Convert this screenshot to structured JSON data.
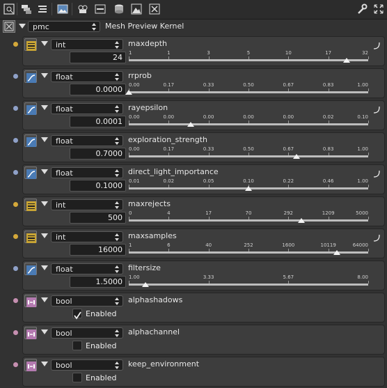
{
  "toolbar": {
    "icons": [
      "render-region-icon",
      "layers-icon",
      "list-icon",
      "picture-icon",
      "camera-icon",
      "film-settings-icon",
      "cylinder-icon",
      "image-icon",
      "fit-icon",
      "wrench-icon",
      "expand-icon"
    ]
  },
  "kernel": {
    "name": "pmc",
    "label": "Mesh Preview Kernel"
  },
  "colors": {
    "pin_int": "#d4a83a",
    "pin_float": "#8fa1c8",
    "pin_bool": "#c58fb0",
    "icon_int": "#c9a534",
    "icon_float": "#4a7bb5",
    "icon_bool": "#b47ab0"
  },
  "params": [
    {
      "type": "int",
      "name": "maxdepth",
      "value": "24",
      "ticks": [
        "1",
        "1",
        "3",
        "5",
        "10",
        "17",
        "32"
      ],
      "slider_fraction": 0.91,
      "has_curve": true
    },
    {
      "type": "float",
      "name": "rrprob",
      "value": "0.0000",
      "ticks": [
        "0.00",
        "0.17",
        "0.33",
        "0.50",
        "0.67",
        "0.83",
        "1.00"
      ],
      "slider_fraction": 0.0,
      "has_curve": false
    },
    {
      "type": "float",
      "name": "rayepsilon",
      "value": "0.0001",
      "ticks": [
        "0.00",
        "0.00",
        "0.00",
        "0.00",
        "0.00",
        "0.02",
        "0.10"
      ],
      "slider_fraction": 0.26,
      "has_curve": true
    },
    {
      "type": "float",
      "name": "exploration_strength",
      "value": "0.7000",
      "ticks": [
        "0.00",
        "0.17",
        "0.33",
        "0.50",
        "0.67",
        "0.83",
        "1.00"
      ],
      "slider_fraction": 0.7,
      "has_curve": false
    },
    {
      "type": "float",
      "name": "direct_light_importance",
      "value": "0.1000",
      "ticks": [
        "0.01",
        "0.02",
        "0.05",
        "0.10",
        "0.22",
        "0.46",
        "1.00"
      ],
      "slider_fraction": 0.5,
      "has_curve": true
    },
    {
      "type": "int",
      "name": "maxrejects",
      "value": "500",
      "ticks": [
        "0",
        "4",
        "17",
        "70",
        "292",
        "1209",
        "5000"
      ],
      "slider_fraction": 0.72,
      "has_curve": false
    },
    {
      "type": "int",
      "name": "maxsamples",
      "value": "16000",
      "ticks": [
        "1",
        "6",
        "40",
        "252",
        "1600",
        "10119",
        "64000"
      ],
      "slider_fraction": 0.87,
      "has_curve": true
    },
    {
      "type": "float",
      "name": "filtersize",
      "value": "1.5000",
      "ticks": [
        "1.00",
        "3.33",
        "5.67",
        "8.00"
      ],
      "slider_fraction": 0.07,
      "has_curve": false
    }
  ],
  "bools": [
    {
      "type": "bool",
      "name": "alphashadows",
      "checked": true,
      "check_label": "Enabled"
    },
    {
      "type": "bool",
      "name": "alphachannel",
      "checked": false,
      "check_label": "Enabled"
    },
    {
      "type": "bool",
      "name": "keep_environment",
      "checked": false,
      "check_label": "Enabled"
    }
  ]
}
